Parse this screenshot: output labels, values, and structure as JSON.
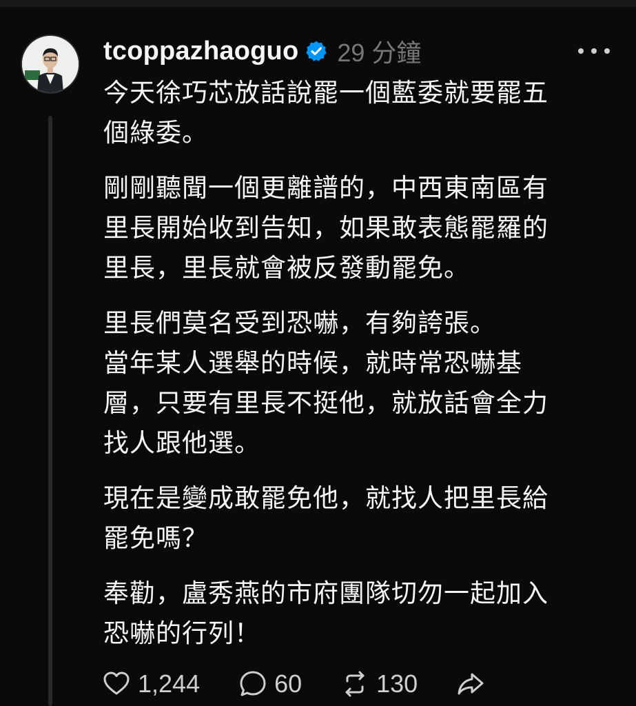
{
  "post": {
    "username": "tcoppazhaoguo",
    "timestamp": "29 分鐘",
    "paragraphs": [
      "今天徐巧芯放話說罷一個藍委就要罷五\n個綠委。",
      "剛剛聽聞一個更離譜的，中西東南區有\n里長開始收到告知，如果敢表態罷羅的\n里長，里長就會被反發動罷免。",
      "里長們莫名受到恐嚇，有夠誇張。\n當年某人選舉的時候，就時常恐嚇基\n層，只要有里長不挺他，就放話會全力\n找人跟他選。",
      "現在是變成敢罷免他，就找人把里長給\n罷免嗎？",
      "奉勸，盧秀燕的市府團隊切勿一起加入\n恐嚇的行列！"
    ]
  },
  "actions": {
    "likes": "1,244",
    "replies": "60",
    "reposts": "130"
  },
  "icons": {
    "verified": "verified-badge-icon",
    "more": "more-dots-icon",
    "like": "heart-icon",
    "reply": "comment-icon",
    "repost": "repost-icon",
    "share": "share-icon"
  },
  "colors": {
    "background": "#0a0a0a",
    "text": "#f3f5f7",
    "muted": "#777777",
    "verified": "#0095f6"
  }
}
